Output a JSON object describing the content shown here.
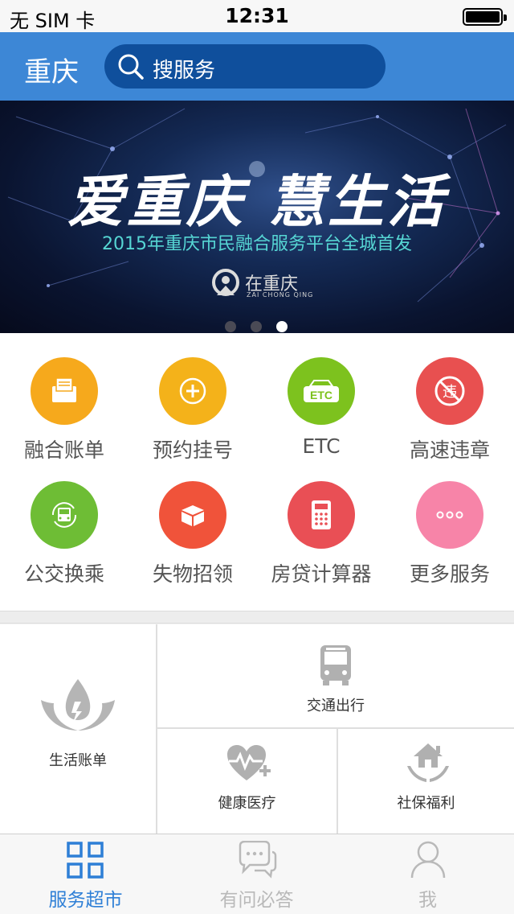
{
  "status_bar": {
    "carrier": "无 SIM 卡",
    "time": "12:31"
  },
  "header": {
    "city": "重庆",
    "search_placeholder": "搜服务"
  },
  "banner": {
    "title": "爱重庆 慧生活",
    "subtitle": "2015年重庆市民融合服务平台全城首发",
    "logo_text": "在重庆",
    "logo_subtext": "ZAI CHONG QING",
    "active_slide": 3,
    "slide_count": 3
  },
  "services": [
    {
      "label": "融合账单",
      "icon": "bill-icon",
      "color": "#f6a91c"
    },
    {
      "label": "预约挂号",
      "icon": "medical-plus-icon",
      "color": "#f4b21a"
    },
    {
      "label": "ETC",
      "icon": "etc-car-icon",
      "color": "#7dc21e"
    },
    {
      "label": "高速违章",
      "icon": "no-violation-icon",
      "color": "#e85050"
    },
    {
      "label": "公交换乘",
      "icon": "bus-transfer-icon",
      "color": "#6ebd35"
    },
    {
      "label": "失物招领",
      "icon": "lost-found-box-icon",
      "color": "#f0533a"
    },
    {
      "label": "房贷计算器",
      "icon": "calculator-icon",
      "color": "#e94f55"
    },
    {
      "label": "更多服务",
      "icon": "more-dots-icon",
      "color": "#f784a8"
    }
  ],
  "etc_icon_text": "ETC",
  "violation_icon_text": "违",
  "cards": {
    "life_bill": "生活账单",
    "transport": "交通出行",
    "health": "健康医疗",
    "social": "社保福利"
  },
  "tabs": [
    {
      "label": "服务超市",
      "icon": "grid-icon",
      "active": true
    },
    {
      "label": "有问必答",
      "icon": "chat-bubble-icon",
      "active": false
    },
    {
      "label": "我",
      "icon": "person-icon",
      "active": false
    }
  ],
  "colors": {
    "accent": "#3d87d6",
    "tab_active": "#2e7fd6",
    "tab_inactive": "#b9b9b9"
  }
}
